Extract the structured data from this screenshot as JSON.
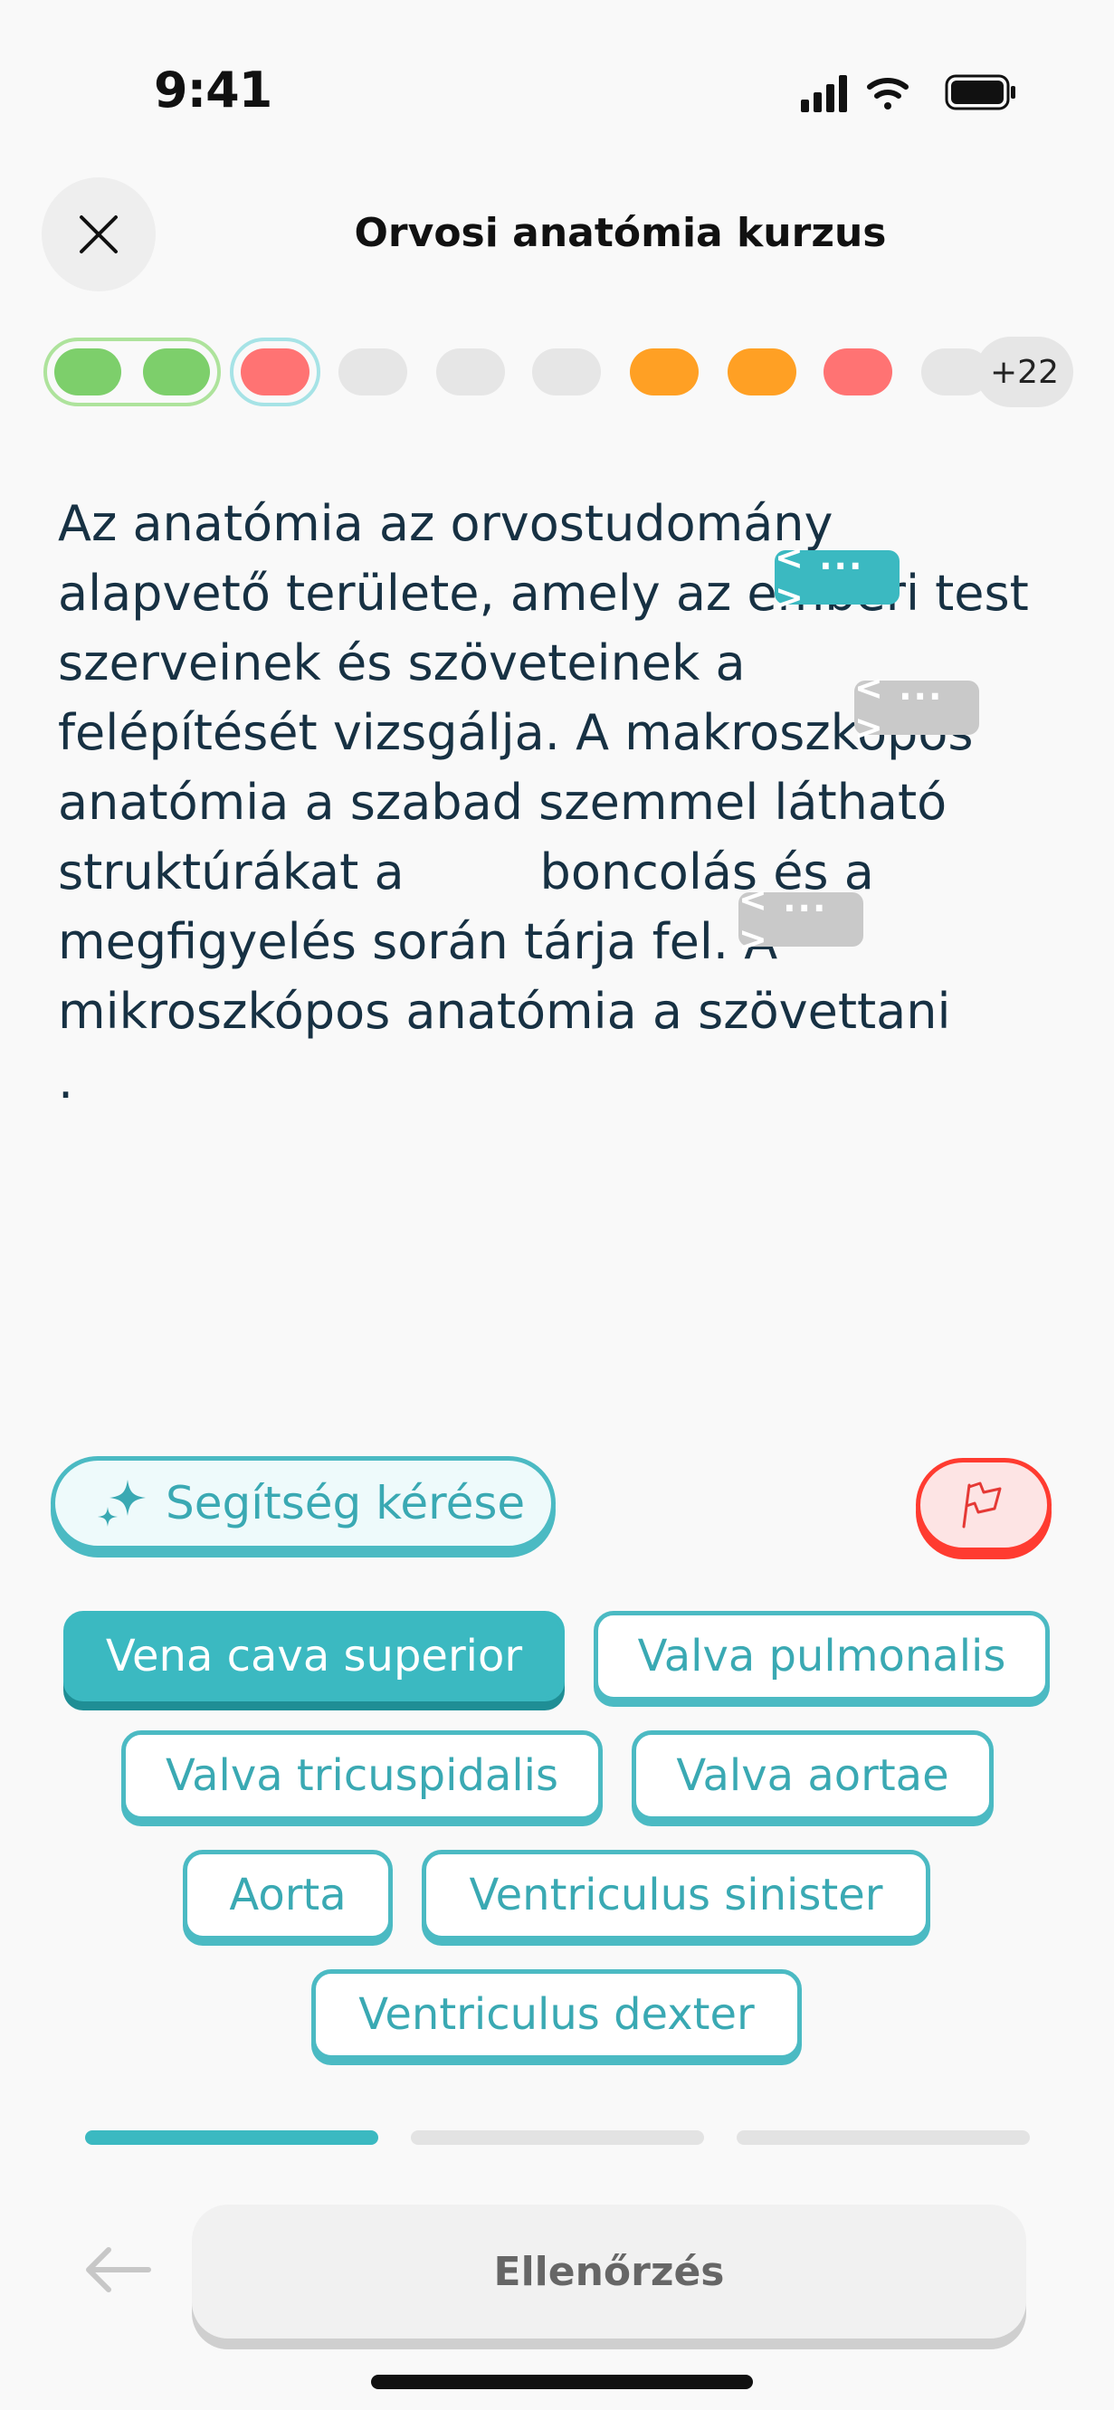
{
  "status_bar": {
    "time": "9:41"
  },
  "header": {
    "title": "Orvosi anatómia kurzus"
  },
  "progress": {
    "more_count": "+22",
    "colors": {
      "correct": "#7dcf6b",
      "wrong": "#ff7373",
      "pending": "#e6e6e6",
      "partial": "#ffa024"
    }
  },
  "passage": {
    "lines": [
      "Az anatómia az orvostudomány",
      "alapvető területe, amely az emberi test",
      "szerveinek és szöveteinek a",
      "felépítését vizsgálja. A makroszkópos",
      "anatómia a szabad szemmel látható",
      "struktúrákat a",
      "boncolás és a",
      "megfigyelés során tárja fel. A",
      "mikroszkópos anatómia a szövettani",
      "."
    ],
    "blank_placeholder": "< ... >"
  },
  "help_button": {
    "label": "Segítség kérése"
  },
  "word_bank": [
    "Vena cava superior",
    "Valva pulmonalis",
    "Valva tricuspidalis",
    "Valva aortae",
    "Aorta",
    "Ventriculus sinister",
    "Ventriculus dexter"
  ],
  "footer": {
    "check_label": "Ellenőrzés"
  },
  "colors": {
    "accent": "#3bb9c1",
    "danger": "#ff3b30",
    "text": "#173143"
  }
}
